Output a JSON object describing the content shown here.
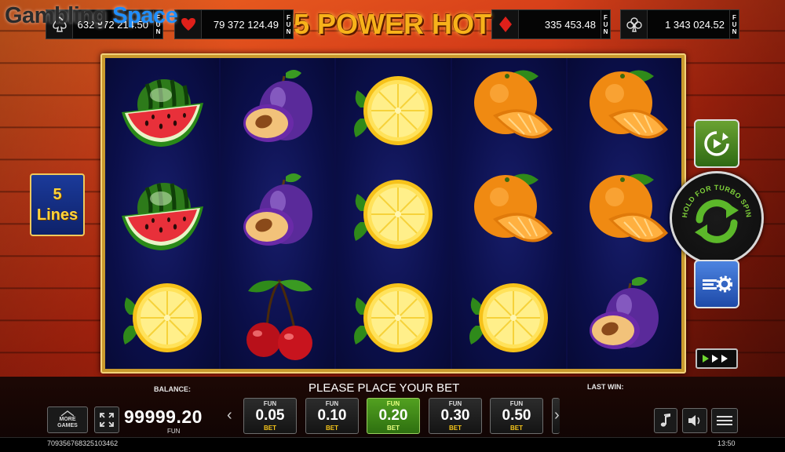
{
  "brand": {
    "logo_part1": "Gambling",
    "logo_part2": "Space"
  },
  "game": {
    "title": "5 POWER HOT"
  },
  "jackpots": [
    {
      "suit": "spade-icon",
      "amount": "632 872 214.50",
      "currency": [
        "F",
        "U",
        "N"
      ]
    },
    {
      "suit": "heart-icon",
      "amount": "79 372 124.49",
      "currency": [
        "F",
        "U",
        "N"
      ]
    },
    {
      "suit": "diamond-icon",
      "amount": "335 453.48",
      "currency": [
        "F",
        "U",
        "N"
      ]
    },
    {
      "suit": "club-icon",
      "amount": "1 343 024.52",
      "currency": [
        "F",
        "U",
        "N"
      ]
    }
  ],
  "lines": {
    "count": "5",
    "label": "Lines"
  },
  "reels": [
    [
      "watermelon",
      "watermelon",
      "lemon"
    ],
    [
      "plum",
      "plum",
      "cherry"
    ],
    [
      "lemon",
      "lemon",
      "lemon"
    ],
    [
      "orange",
      "orange",
      "lemon"
    ],
    [
      "orange",
      "orange",
      "plum"
    ]
  ],
  "controls": {
    "spin_hint": "HOLD FOR TURBO SPIN",
    "autoplay_icon": "autoplay-icon",
    "settings_icon": "settings-icon",
    "turbo_icon": "fast-forward-icon"
  },
  "bottom": {
    "balance_label": "BALANCE:",
    "balance_value": "99999.20",
    "balance_currency": "FUN",
    "message": "PLEASE PLACE YOUR BET",
    "last_win_label": "LAST WIN:",
    "more_games_line1": "MORE",
    "more_games_line2": "GAMES",
    "bets": [
      {
        "top": "FUN",
        "value": "0.05",
        "bottom": "BET",
        "selected": false
      },
      {
        "top": "FUN",
        "value": "0.10",
        "bottom": "BET",
        "selected": false
      },
      {
        "top": "FUN",
        "value": "0.20",
        "bottom": "BET",
        "selected": true
      },
      {
        "top": "FUN",
        "value": "0.30",
        "bottom": "BET",
        "selected": false
      },
      {
        "top": "FUN",
        "value": "0.50",
        "bottom": "BET",
        "selected": false
      }
    ],
    "ticket_id": "709356768325103462",
    "clock": "13:50"
  }
}
